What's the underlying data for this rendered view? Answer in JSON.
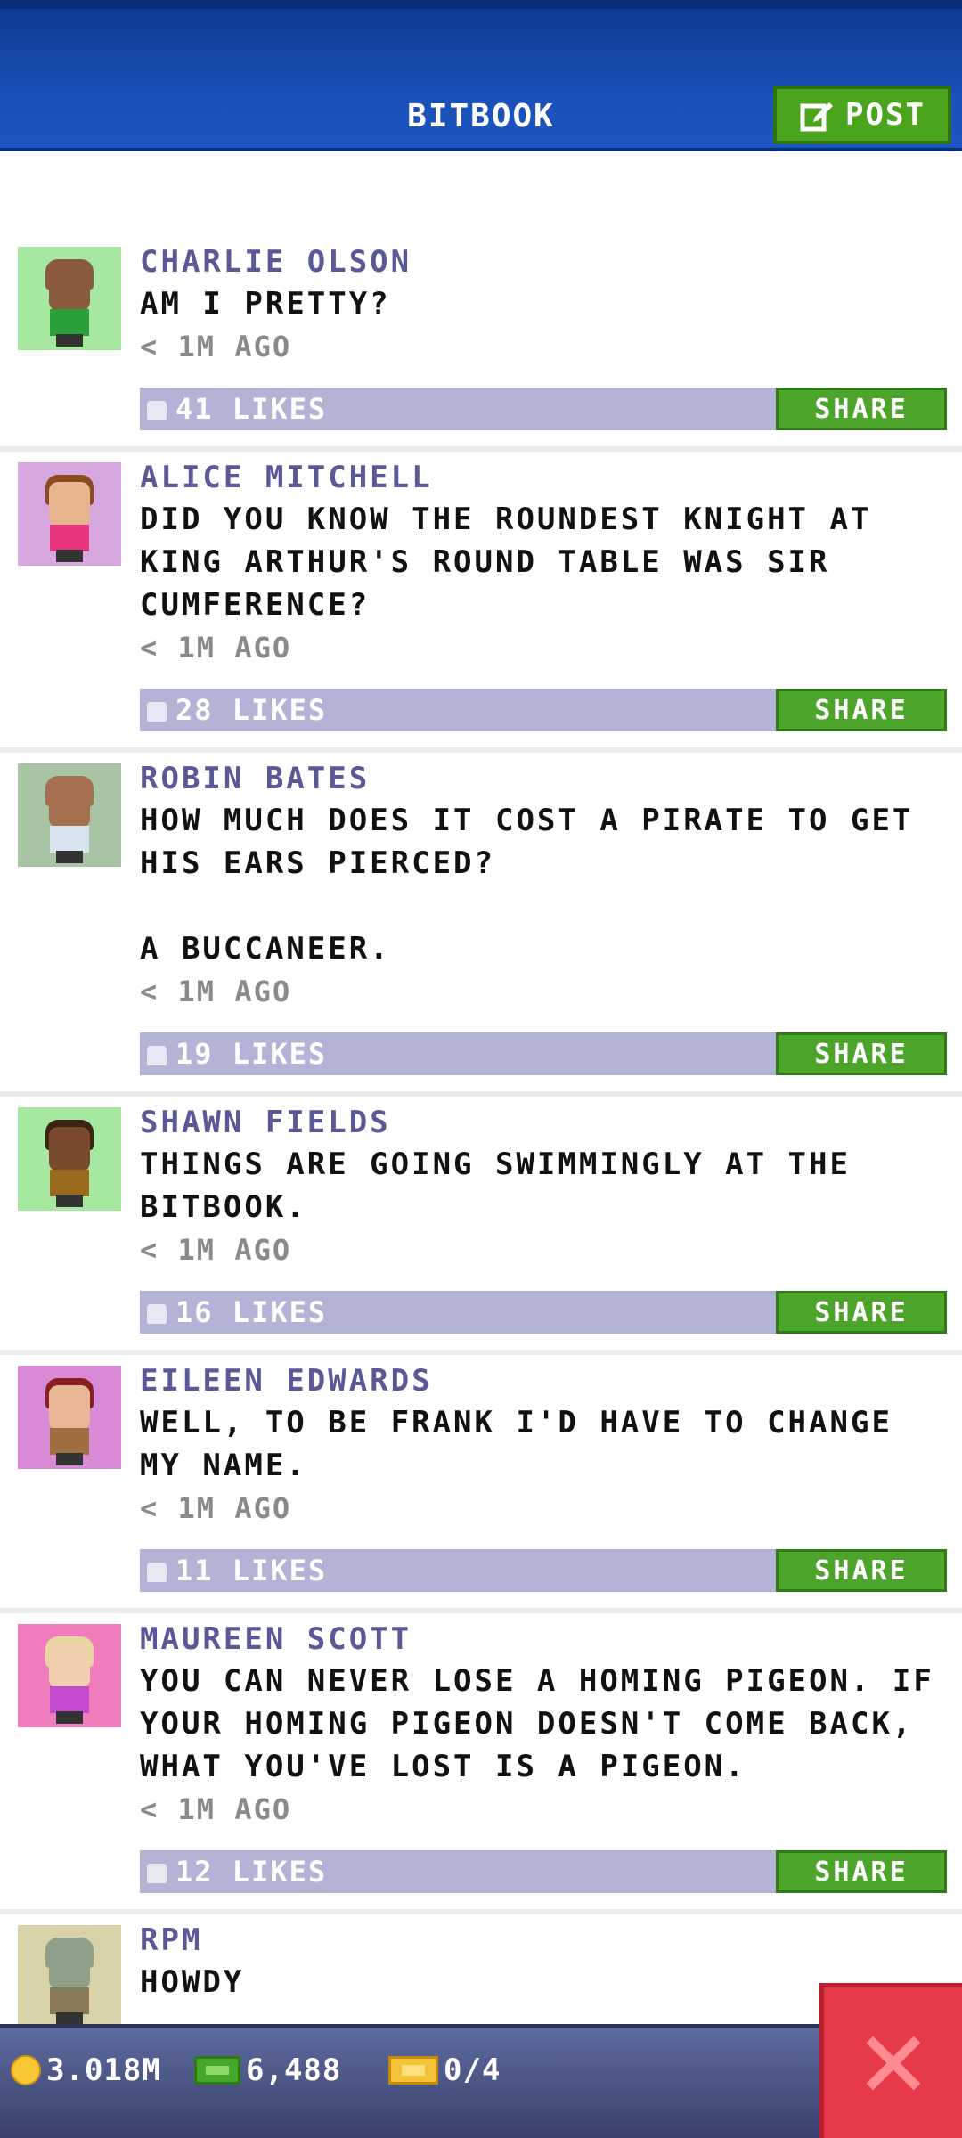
{
  "header": {
    "title": "BITBOOK",
    "post_label": "POST"
  },
  "posts": [
    {
      "author": "CHARLIE OLSON",
      "message": "AM I PRETTY?",
      "time": "< 1M AGO",
      "likes": "41 LIKES",
      "share": "SHARE",
      "avatar": {
        "bg": "#a6e8a0",
        "skin": "#8a5a3c",
        "hair": "#8a5a3c",
        "shirt": "#2a9f3a"
      }
    },
    {
      "author": "ALICE MITCHELL",
      "message": "DID YOU KNOW THE ROUNDEST KNIGHT AT KING ARTHUR'S ROUND TABLE WAS SIR CUMFERENCE?",
      "time": "< 1M AGO",
      "likes": "28 LIKES",
      "share": "SHARE",
      "avatar": {
        "bg": "#d7a8df",
        "skin": "#e7b58f",
        "hair": "#8a4a22",
        "shirt": "#e8357e"
      }
    },
    {
      "author": "ROBIN BATES",
      "message": "HOW MUCH DOES IT COST A PIRATE TO GET HIS EARS PIERCED?\n\nA BUCCANEER.",
      "time": "< 1M AGO",
      "likes": "19 LIKES",
      "share": "SHARE",
      "avatar": {
        "bg": "#a9c4a4",
        "skin": "#a4704f",
        "hair": "#a4704f",
        "shirt": "#d7e4ef"
      }
    },
    {
      "author": "SHAWN FIELDS",
      "message": "THINGS ARE GOING SWIMMINGLY AT THE BITBOOK.",
      "time": "< 1M AGO",
      "likes": "16 LIKES",
      "share": "SHARE",
      "avatar": {
        "bg": "#a6e8a0",
        "skin": "#7a4a2c",
        "hair": "#3a2414",
        "shirt": "#9a6a1c"
      }
    },
    {
      "author": "EILEEN EDWARDS",
      "message": "WELL, TO BE FRANK I'D HAVE TO CHANGE MY NAME.",
      "time": "< 1M AGO",
      "likes": "11 LIKES",
      "share": "SHARE",
      "avatar": {
        "bg": "#d98ad6",
        "skin": "#e8b896",
        "hair": "#8a1e22",
        "shirt": "#a07040"
      }
    },
    {
      "author": "MAUREEN SCOTT",
      "message": "YOU CAN NEVER LOSE A HOMING PIGEON. IF YOUR HOMING PIGEON DOESN'T COME BACK, WHAT YOU'VE LOST IS A PIGEON.",
      "time": "< 1M AGO",
      "likes": "12 LIKES",
      "share": "SHARE",
      "avatar": {
        "bg": "#f07cbc",
        "skin": "#f2cfae",
        "hair": "#e6d7a0",
        "shirt": "#c44ad0"
      }
    },
    {
      "author": "RPM",
      "message": "HOWDY",
      "time": "",
      "likes": "",
      "share": "",
      "avatar": {
        "bg": "#d9d2a8",
        "skin": "#8fa08a",
        "hair": "#8fa08a",
        "shirt": "#8a7a5a"
      }
    }
  ],
  "bottom_bar": {
    "coins": "3.018M",
    "bux": "6,488",
    "tickets": "0/4"
  },
  "colors": {
    "header": "#1a4fb8",
    "post_button": "#4aa51d",
    "likes_bar": "#b3b3d6",
    "share_button": "#4ca52a",
    "close_button": "#e8394a"
  },
  "icons": {
    "post": "edit-icon",
    "like": "thumbs-up-icon",
    "coin": "coin-icon",
    "bux": "bux-icon",
    "ticket": "ticket-icon",
    "close": "close-icon"
  }
}
